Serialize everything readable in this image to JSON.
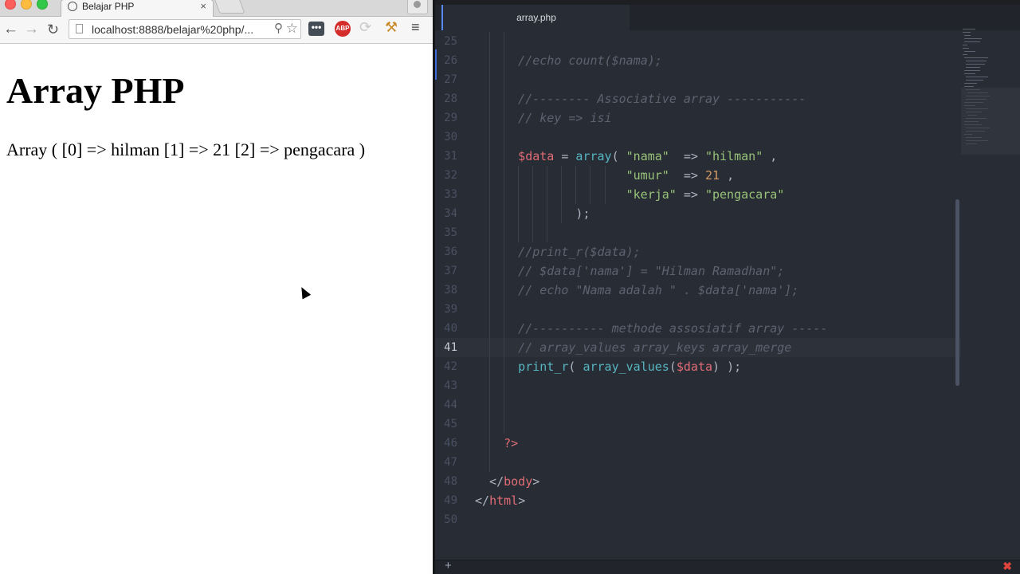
{
  "browser": {
    "tab_title": "Belajar PHP",
    "tab_close": "×",
    "url": "localhost:8888/belajar%20php/...",
    "extensions": {
      "dots_label": "•••",
      "abp_label": "ABP"
    },
    "page": {
      "heading": "Array PHP",
      "output": "Array ( [0] => hilman [1] => 21 [2] => pengacara )"
    }
  },
  "editor": {
    "tab_title": "array.php",
    "status_plus": "+",
    "status_error": "✖",
    "current_line": 41,
    "lines": [
      {
        "n": "25",
        "text": ""
      },
      {
        "n": "26",
        "text": "//echo count($nama);"
      },
      {
        "n": "27",
        "text": ""
      },
      {
        "n": "28",
        "text": "//-------- Associative array -----------"
      },
      {
        "n": "29",
        "text": "// key => isi"
      },
      {
        "n": "30",
        "text": ""
      },
      {
        "n": "31",
        "text": "$data = array( \"nama\"  => \"hilman\" ,"
      },
      {
        "n": "32",
        "text": "\"umur\"  => 21 ,"
      },
      {
        "n": "33",
        "text": "\"kerja\" => \"pengacara\""
      },
      {
        "n": "34",
        "text": ");"
      },
      {
        "n": "35",
        "text": ""
      },
      {
        "n": "36",
        "text": "//print_r($data);"
      },
      {
        "n": "37",
        "text": "// $data['nama'] = \"Hilman Ramadhan\";"
      },
      {
        "n": "38",
        "text": "// echo \"Nama adalah \" . $data['nama'];"
      },
      {
        "n": "39",
        "text": ""
      },
      {
        "n": "40",
        "text": "//---------- methode assosiatif array -----"
      },
      {
        "n": "41",
        "text": "// array_values array_keys array_merge"
      },
      {
        "n": "42",
        "text": "print_r( array_values($data) );"
      },
      {
        "n": "43",
        "text": ""
      },
      {
        "n": "44",
        "text": ""
      },
      {
        "n": "45",
        "text": ""
      },
      {
        "n": "46",
        "text": "?>"
      },
      {
        "n": "47",
        "text": ""
      },
      {
        "n": "48",
        "text": "</body>"
      },
      {
        "n": "49",
        "text": "</html>"
      },
      {
        "n": "50",
        "text": ""
      }
    ]
  }
}
